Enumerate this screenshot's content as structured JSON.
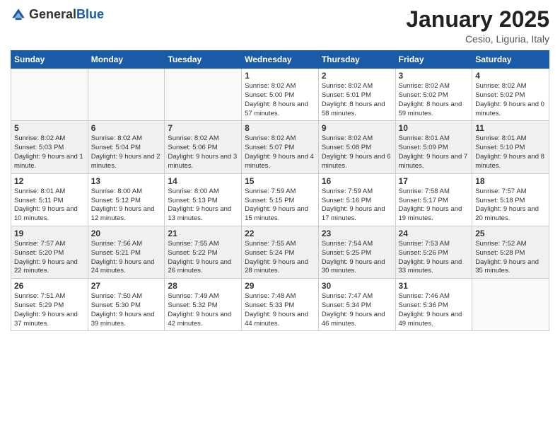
{
  "logo": {
    "general": "General",
    "blue": "Blue"
  },
  "title": "January 2025",
  "location": "Cesio, Liguria, Italy",
  "days_of_week": [
    "Sunday",
    "Monday",
    "Tuesday",
    "Wednesday",
    "Thursday",
    "Friday",
    "Saturday"
  ],
  "weeks": [
    [
      {
        "day": "",
        "empty": true
      },
      {
        "day": "",
        "empty": true
      },
      {
        "day": "",
        "empty": true
      },
      {
        "day": "1",
        "info": "Sunrise: 8:02 AM\nSunset: 5:00 PM\nDaylight: 8 hours and 57 minutes."
      },
      {
        "day": "2",
        "info": "Sunrise: 8:02 AM\nSunset: 5:01 PM\nDaylight: 8 hours and 58 minutes."
      },
      {
        "day": "3",
        "info": "Sunrise: 8:02 AM\nSunset: 5:02 PM\nDaylight: 8 hours and 59 minutes."
      },
      {
        "day": "4",
        "info": "Sunrise: 8:02 AM\nSunset: 5:02 PM\nDaylight: 9 hours and 0 minutes."
      }
    ],
    [
      {
        "day": "5",
        "info": "Sunrise: 8:02 AM\nSunset: 5:03 PM\nDaylight: 9 hours and 1 minute."
      },
      {
        "day": "6",
        "info": "Sunrise: 8:02 AM\nSunset: 5:04 PM\nDaylight: 9 hours and 2 minutes."
      },
      {
        "day": "7",
        "info": "Sunrise: 8:02 AM\nSunset: 5:06 PM\nDaylight: 9 hours and 3 minutes."
      },
      {
        "day": "8",
        "info": "Sunrise: 8:02 AM\nSunset: 5:07 PM\nDaylight: 9 hours and 4 minutes."
      },
      {
        "day": "9",
        "info": "Sunrise: 8:02 AM\nSunset: 5:08 PM\nDaylight: 9 hours and 6 minutes."
      },
      {
        "day": "10",
        "info": "Sunrise: 8:01 AM\nSunset: 5:09 PM\nDaylight: 9 hours and 7 minutes."
      },
      {
        "day": "11",
        "info": "Sunrise: 8:01 AM\nSunset: 5:10 PM\nDaylight: 9 hours and 8 minutes."
      }
    ],
    [
      {
        "day": "12",
        "info": "Sunrise: 8:01 AM\nSunset: 5:11 PM\nDaylight: 9 hours and 10 minutes."
      },
      {
        "day": "13",
        "info": "Sunrise: 8:00 AM\nSunset: 5:12 PM\nDaylight: 9 hours and 12 minutes."
      },
      {
        "day": "14",
        "info": "Sunrise: 8:00 AM\nSunset: 5:13 PM\nDaylight: 9 hours and 13 minutes."
      },
      {
        "day": "15",
        "info": "Sunrise: 7:59 AM\nSunset: 5:15 PM\nDaylight: 9 hours and 15 minutes."
      },
      {
        "day": "16",
        "info": "Sunrise: 7:59 AM\nSunset: 5:16 PM\nDaylight: 9 hours and 17 minutes."
      },
      {
        "day": "17",
        "info": "Sunrise: 7:58 AM\nSunset: 5:17 PM\nDaylight: 9 hours and 19 minutes."
      },
      {
        "day": "18",
        "info": "Sunrise: 7:57 AM\nSunset: 5:18 PM\nDaylight: 9 hours and 20 minutes."
      }
    ],
    [
      {
        "day": "19",
        "info": "Sunrise: 7:57 AM\nSunset: 5:20 PM\nDaylight: 9 hours and 22 minutes."
      },
      {
        "day": "20",
        "info": "Sunrise: 7:56 AM\nSunset: 5:21 PM\nDaylight: 9 hours and 24 minutes."
      },
      {
        "day": "21",
        "info": "Sunrise: 7:55 AM\nSunset: 5:22 PM\nDaylight: 9 hours and 26 minutes."
      },
      {
        "day": "22",
        "info": "Sunrise: 7:55 AM\nSunset: 5:24 PM\nDaylight: 9 hours and 28 minutes."
      },
      {
        "day": "23",
        "info": "Sunrise: 7:54 AM\nSunset: 5:25 PM\nDaylight: 9 hours and 30 minutes."
      },
      {
        "day": "24",
        "info": "Sunrise: 7:53 AM\nSunset: 5:26 PM\nDaylight: 9 hours and 33 minutes."
      },
      {
        "day": "25",
        "info": "Sunrise: 7:52 AM\nSunset: 5:28 PM\nDaylight: 9 hours and 35 minutes."
      }
    ],
    [
      {
        "day": "26",
        "info": "Sunrise: 7:51 AM\nSunset: 5:29 PM\nDaylight: 9 hours and 37 minutes."
      },
      {
        "day": "27",
        "info": "Sunrise: 7:50 AM\nSunset: 5:30 PM\nDaylight: 9 hours and 39 minutes."
      },
      {
        "day": "28",
        "info": "Sunrise: 7:49 AM\nSunset: 5:32 PM\nDaylight: 9 hours and 42 minutes."
      },
      {
        "day": "29",
        "info": "Sunrise: 7:48 AM\nSunset: 5:33 PM\nDaylight: 9 hours and 44 minutes."
      },
      {
        "day": "30",
        "info": "Sunrise: 7:47 AM\nSunset: 5:34 PM\nDaylight: 9 hours and 46 minutes."
      },
      {
        "day": "31",
        "info": "Sunrise: 7:46 AM\nSunset: 5:36 PM\nDaylight: 9 hours and 49 minutes."
      },
      {
        "day": "",
        "empty": true
      }
    ]
  ]
}
